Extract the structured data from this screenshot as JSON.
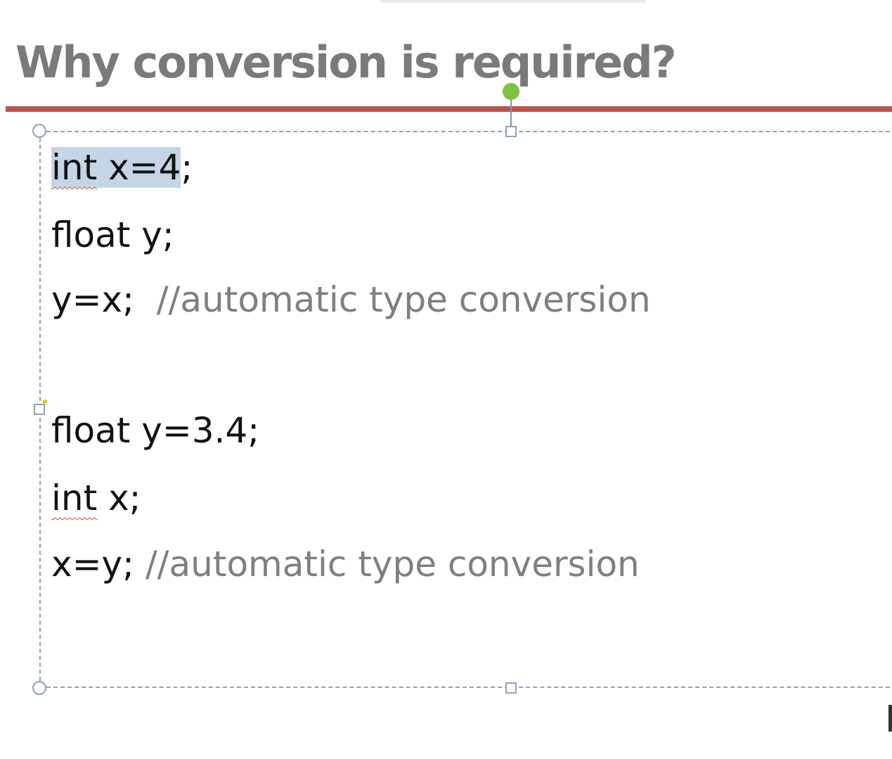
{
  "slide": {
    "title": "Why conversion is required?",
    "accent_color": "#c0504d",
    "title_color": "#7a7a7a",
    "comment_color": "#7f7f7f",
    "selection_color": "#c5d5e6"
  },
  "code_block": {
    "line1": {
      "keyword": "int",
      "selected_rest": " x=4",
      "tail": ";"
    },
    "line2": {
      "text": "float y;"
    },
    "line3": {
      "code": "y=x;",
      "comment": "  //automatic type conversion"
    },
    "line4": {
      "text": "float y=3.4;"
    },
    "line5": {
      "keyword": "int",
      "rest": " x;"
    },
    "line6": {
      "code": "x=y;",
      "comment": " //automatic type conversion"
    }
  }
}
